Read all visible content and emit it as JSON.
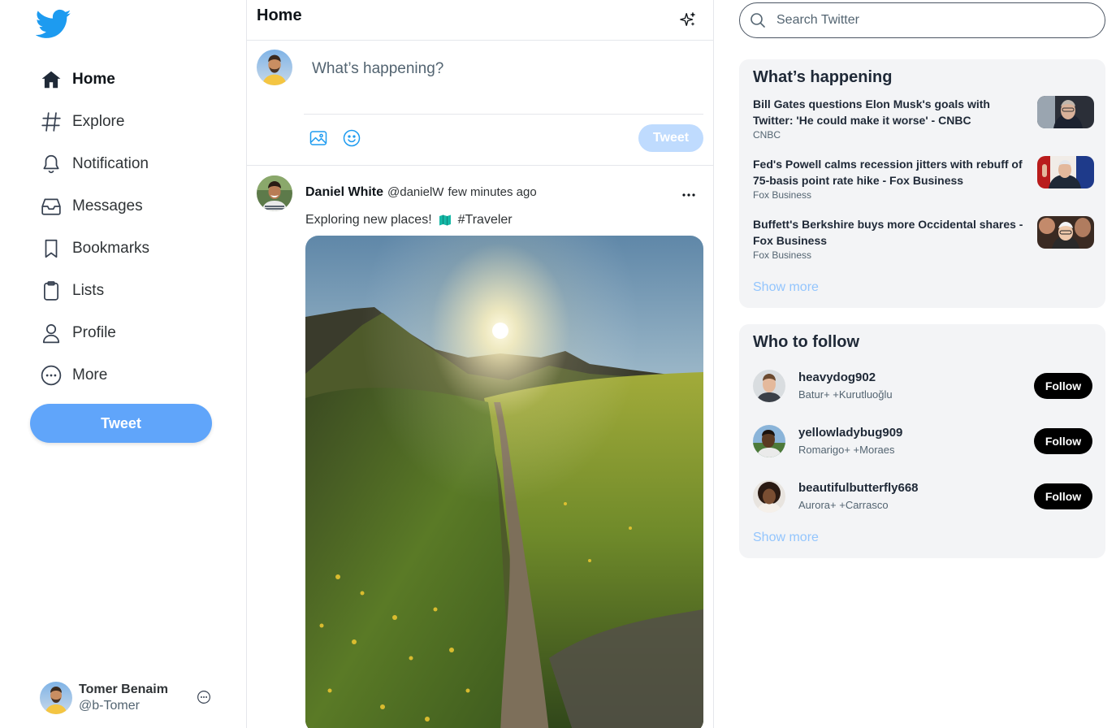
{
  "colors": {
    "brand": "#1d9bf0",
    "tweet_button": "#60a5fa",
    "tweet_button_disabled": "#bfdbfe",
    "show_more": "#93c5fd",
    "panel_bg": "#f3f4f6"
  },
  "sidebar": {
    "logo_icon": "twitter-bird-icon",
    "items": [
      {
        "label": "Home",
        "icon": "home-icon",
        "active": true
      },
      {
        "label": "Explore",
        "icon": "hashtag-icon"
      },
      {
        "label": "Notification",
        "icon": "bell-icon"
      },
      {
        "label": "Messages",
        "icon": "inbox-icon"
      },
      {
        "label": "Bookmarks",
        "icon": "bookmark-icon"
      },
      {
        "label": "Lists",
        "icon": "clipboard-icon"
      },
      {
        "label": "Profile",
        "icon": "user-icon"
      },
      {
        "label": "More",
        "icon": "more-circle-icon"
      }
    ],
    "tweet_label": "Tweet",
    "account": {
      "name": "Tomer Benaim",
      "handle": "@b-Tomer"
    }
  },
  "main": {
    "title": "Home",
    "composer": {
      "placeholder": "What’s happening?",
      "tweet_label": "Tweet"
    },
    "post": {
      "author": "Daniel White",
      "handle": "@danielW",
      "time": "few minutes ago",
      "text": "Exploring new places!",
      "hashtag": "#Traveler"
    }
  },
  "right": {
    "search_placeholder": "Search Twitter",
    "trends": {
      "title": "What’s happening",
      "items": [
        {
          "headline": "Bill Gates questions Elon Musk's goals with Twitter: 'He could make it worse' - CNBC",
          "source": "CNBC"
        },
        {
          "headline": "Fed's Powell calms recession jitters with rebuff of 75-basis point rate hike - Fox Business",
          "source": "Fox Business"
        },
        {
          "headline": "Buffett's Berkshire buys more Occidental shares - Fox Business",
          "source": "Fox Business"
        }
      ],
      "show_more": "Show more"
    },
    "who_to_follow": {
      "title": "Who to follow",
      "items": [
        {
          "username": "heavydog902",
          "subtitle": "Batur+ +Kurutluoğlu",
          "button": "Follow"
        },
        {
          "username": "yellowladybug909",
          "subtitle": "Romarigo+ +Moraes",
          "button": "Follow"
        },
        {
          "username": "beautifulbutterfly668",
          "subtitle": "Aurora+ +Carrasco",
          "button": "Follow"
        }
      ],
      "show_more": "Show more"
    }
  }
}
